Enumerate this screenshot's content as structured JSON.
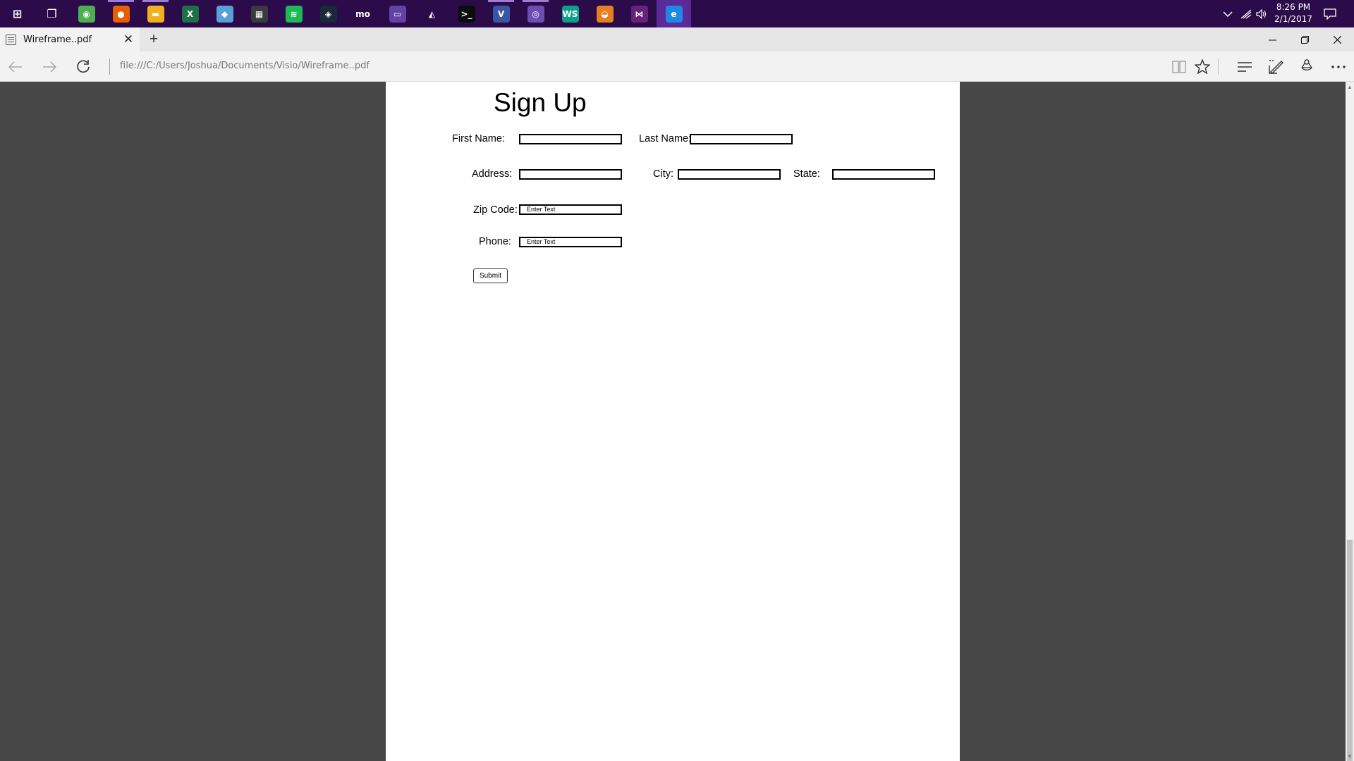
{
  "taskbar": {
    "apps": [
      {
        "name": "start-button",
        "glyph": "⊞",
        "color": "#2b0b4a"
      },
      {
        "name": "task-view-button",
        "glyph": "❐",
        "color": "#2b0b4a"
      },
      {
        "name": "chrome-icon",
        "glyph": "◉",
        "color": "#4caf50"
      },
      {
        "name": "firefox-icon",
        "glyph": "●",
        "color": "#e66000"
      },
      {
        "name": "file-explorer-icon",
        "glyph": "▬",
        "color": "#f2b01e"
      },
      {
        "name": "excel-icon",
        "glyph": "X",
        "color": "#1e7145"
      },
      {
        "name": "visio-viewer-icon",
        "glyph": "◆",
        "color": "#5aa0d8"
      },
      {
        "name": "calculator-icon",
        "glyph": "▦",
        "color": "#3b3b3b"
      },
      {
        "name": "spotify-icon",
        "glyph": "≋",
        "color": "#1db954"
      },
      {
        "name": "steam-icon",
        "glyph": "◈",
        "color": "#1b2838"
      },
      {
        "name": "mo-app-icon",
        "glyph": "mo",
        "color": "#2b0b4a"
      },
      {
        "name": "twitch-icon",
        "glyph": "▭",
        "color": "#6441a5"
      },
      {
        "name": "unity-icon",
        "glyph": "◭",
        "color": "#2b0b4a"
      },
      {
        "name": "terminal-icon",
        "glyph": ">_",
        "color": "#0c0c0c"
      },
      {
        "name": "visio-icon",
        "glyph": "V",
        "color": "#3955a3"
      },
      {
        "name": "media-app-icon",
        "glyph": "◎",
        "color": "#6a4fb0"
      },
      {
        "name": "webstorm-icon",
        "glyph": "WS",
        "color": "#0f9e8c"
      },
      {
        "name": "app-icon",
        "glyph": "◒",
        "color": "#e67e22"
      },
      {
        "name": "visual-studio-icon",
        "glyph": "⋈",
        "color": "#68217a"
      },
      {
        "name": "edge-icon",
        "glyph": "e",
        "color": "#1e88e5"
      }
    ],
    "time": "8:26 PM",
    "date": "2/1/2017"
  },
  "browser": {
    "tab_title": "Wireframe..pdf",
    "url": "file:///C:/Users/Joshua/Documents/Visio/Wireframe..pdf"
  },
  "form": {
    "title": "Sign Up",
    "first_name_label": "First Name:",
    "last_name_label": "Last Name:",
    "address_label": "Address:",
    "city_label": "City:",
    "state_label": "State:",
    "zip_label": "Zip Code:",
    "zip_placeholder": "Enter Text",
    "phone_label": "Phone:",
    "phone_placeholder": "Enter Text",
    "submit_label": "Submit"
  }
}
